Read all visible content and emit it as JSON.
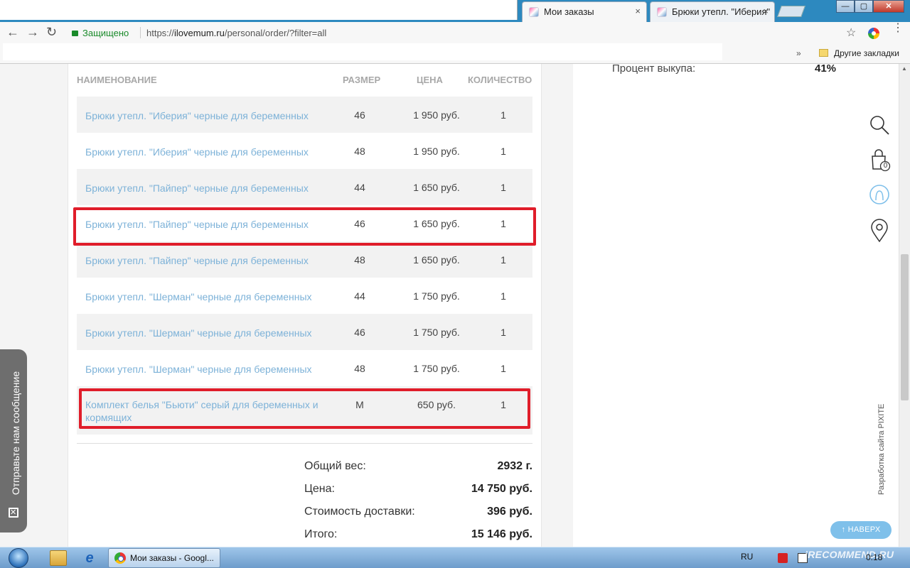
{
  "browser": {
    "tabs": [
      {
        "title": "Мои заказы",
        "close": "×"
      },
      {
        "title": "Брюки утепл. \"Иберия\"",
        "close": "×"
      }
    ],
    "window_buttons": {
      "minimize": "—",
      "maximize": "▢",
      "close": "✕"
    },
    "nav": {
      "back": "←",
      "forward": "→",
      "reload": "↻"
    },
    "secure_label": "Защищено",
    "url_prefix": "https://",
    "url_host": "ilovemum.ru",
    "url_path": "/personal/order/?filter=all",
    "star": "☆",
    "menu": "⋮",
    "bookmarks_more": "»",
    "bookmarks_other": "Другие закладки"
  },
  "right_panel": {
    "label": "Процент выкупа:",
    "value": "41%"
  },
  "table": {
    "headers": {
      "name": "НАИМЕНОВАНИЕ",
      "size": "РАЗМЕР",
      "price": "ЦЕНА",
      "qty": "КОЛИЧЕСТВО"
    },
    "rows": [
      {
        "name": "Брюки утепл. \"Иберия\" черные для беременных",
        "size": "46",
        "price": "1 950 руб.",
        "qty": "1"
      },
      {
        "name": "Брюки утепл. \"Иберия\" черные для беременных",
        "size": "48",
        "price": "1 950 руб.",
        "qty": "1"
      },
      {
        "name": "Брюки утепл. \"Пайпер\" черные для беременных",
        "size": "44",
        "price": "1 650 руб.",
        "qty": "1"
      },
      {
        "name": "Брюки утепл. \"Пайпер\" черные для беременных",
        "size": "46",
        "price": "1 650 руб.",
        "qty": "1"
      },
      {
        "name": "Брюки утепл. \"Пайпер\" черные для беременных",
        "size": "48",
        "price": "1 650 руб.",
        "qty": "1"
      },
      {
        "name": "Брюки утепл. \"Шерман\" черные для беременных",
        "size": "44",
        "price": "1 750 руб.",
        "qty": "1"
      },
      {
        "name": "Брюки утепл. \"Шерман\" черные для беременных",
        "size": "46",
        "price": "1 750 руб.",
        "qty": "1"
      },
      {
        "name": "Брюки утепл. \"Шерман\" черные для беременных",
        "size": "48",
        "price": "1 750 руб.",
        "qty": "1"
      },
      {
        "name": "Комплект белья \"Бьюти\" серый для беременных и кормящих",
        "size": "M",
        "price": "650 руб.",
        "qty": "1"
      }
    ]
  },
  "summary": {
    "weight_label": "Общий вес:",
    "weight": "2932 г.",
    "price_label": "Цена:",
    "price": "14 750 руб.",
    "delivery_label": "Стоимость доставки:",
    "delivery": "396 руб.",
    "total_label": "Итого:",
    "total": "15 146 руб."
  },
  "side_icons": {
    "cart_count": "0"
  },
  "developer_credit": "Разработка сайта PIXITE",
  "scroll_top_button": "↑ НАВЕРХ",
  "feedback_tab": "Отправьте нам сообщение",
  "taskbar": {
    "chrome_window": "Мои заказы - Googl...",
    "lang": "RU",
    "clock": "0:18",
    "watermark": "iRECOMMEND.RU"
  },
  "colors": {
    "link": "#7db2d8",
    "highlight": "#e01d2a",
    "accent": "#7fc0ea"
  }
}
